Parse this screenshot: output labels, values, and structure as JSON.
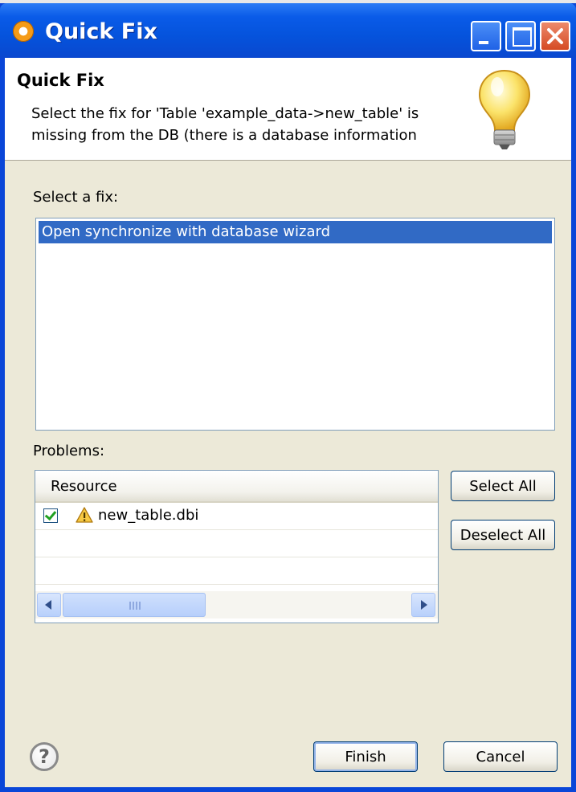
{
  "window": {
    "title": "Quick Fix",
    "icon": "eclipse-icon",
    "controls": [
      "minimize-icon",
      "maximize-icon",
      "close-icon"
    ]
  },
  "header": {
    "title": "Quick Fix",
    "message_line1": "Select the fix for 'Table 'example_data->new_table' is",
    "message_line2": "missing from the DB (there is a database information",
    "icon": "lightbulb-icon"
  },
  "fixes": {
    "label": "Select a fix:",
    "items": [
      "Open synchronize with database wizard"
    ],
    "selected_index": 0
  },
  "problems": {
    "label": "Problems:",
    "column_header": "Resource",
    "rows": [
      {
        "checked": true,
        "icon": "warning-icon",
        "resource": "new_table.dbi"
      }
    ],
    "select_all_label": "Select All",
    "deselect_all_label": "Deselect All"
  },
  "footer": {
    "help_icon": "help-icon",
    "help_glyph": "?",
    "finish_label": "Finish",
    "cancel_label": "Cancel"
  },
  "colors": {
    "title_bar": "#0553dc",
    "selection": "#316ac5",
    "dialog_bg": "#ece9d8",
    "close_button": "#d54a22"
  }
}
